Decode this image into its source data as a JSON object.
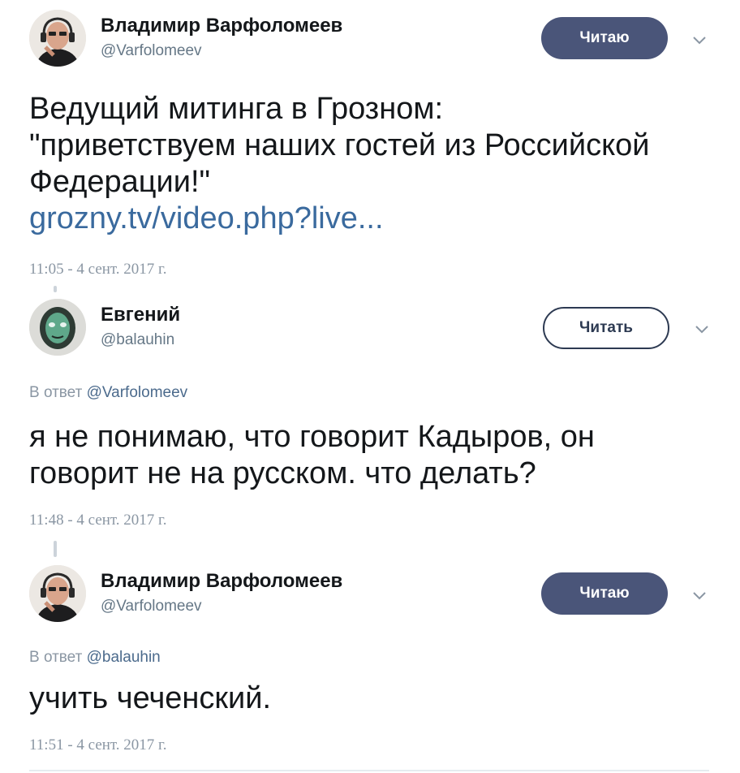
{
  "tweets": [
    {
      "author_name": "Владимир Варфоломеев",
      "author_handle": "@Varfolomeev",
      "button_label": "Читаю",
      "button_state": "following",
      "text_lines": [
        "Ведущий митинга в Грозном:",
        "\"приветствуем наших гостей из Российской",
        "Федерации!\""
      ],
      "link_text": "grozny.tv/video.php?live...",
      "timestamp": "11:05 - 4 сент. 2017 г."
    },
    {
      "author_name": "Евгений",
      "author_handle": "@balauhin",
      "button_label": "Читать",
      "button_state": "not-following",
      "reply_prefix": "В ответ",
      "reply_to": "@Varfolomeev",
      "text_lines": [
        "я не понимаю, что говорит Кадыров, он",
        "говорит не на русском. что делать?"
      ],
      "timestamp": "11:48 - 4 сент. 2017 г."
    },
    {
      "author_name": "Владимир Варфоломеев",
      "author_handle": "@Varfolomeev",
      "button_label": "Читаю",
      "button_state": "following",
      "reply_prefix": "В ответ",
      "reply_to": "@balauhin",
      "text_lines": [
        "учить чеченский."
      ],
      "timestamp": "11:51 - 4 сент. 2017 г."
    }
  ],
  "icons": {
    "menu": "chevron-down-icon"
  },
  "colors": {
    "following_button": "#4a5579",
    "follow_button_border": "#2d3a52",
    "link": "#3a6a9e",
    "meta_text": "#8a96a3"
  }
}
